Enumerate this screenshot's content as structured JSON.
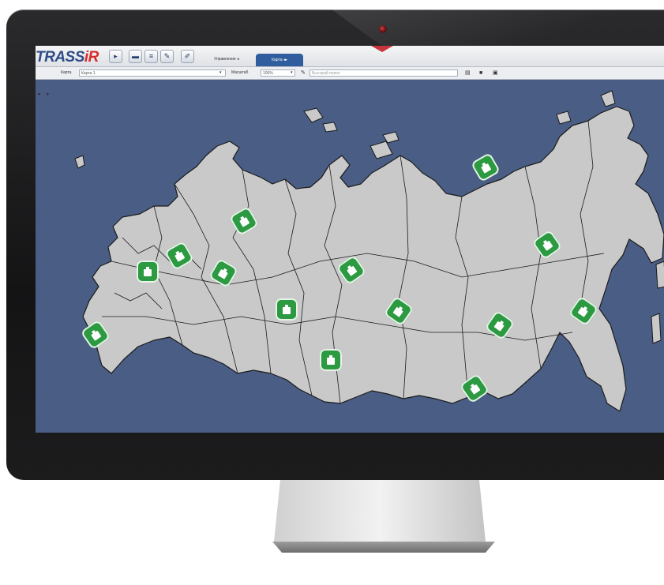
{
  "app": {
    "logo_text": "TRASS",
    "logo_accent": "iR",
    "brand_color": "#2f4d88",
    "accent_color": "#d92b2b"
  },
  "tabs": [
    {
      "label": "Управление"
    },
    {
      "label": "Карта"
    }
  ],
  "toolbar2": {
    "map_label": "Карта",
    "map_value": "Карта 1",
    "scale_label": "Масштаб",
    "scale_value": "100%",
    "search_placeholder": "Быстрый поиск"
  },
  "map": {
    "background_color": "#4a5d84",
    "land_color": "#c8c8c8",
    "marker_color": "#2b9a40",
    "marker_icon": "camera-icon",
    "marker_count": 14
  }
}
